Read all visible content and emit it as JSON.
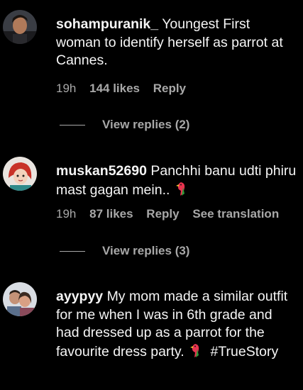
{
  "comments": [
    {
      "username": "sohampuranik_",
      "text": "Youngest First woman to identify herself as parrot at Cannes.",
      "time": "19h",
      "likes": "144 likes",
      "reply": "Reply",
      "view_replies": "View replies (2)"
    },
    {
      "username": "muskan52690",
      "text": "Panchhi banu udti phiru mast gagan mein..",
      "emoji": "parrot-emoji",
      "time": "19h",
      "likes": "87 likes",
      "reply": "Reply",
      "translation": "See translation",
      "view_replies": "View replies (3)"
    },
    {
      "username": "ayypyy",
      "text": "My mom made a similar outfit for me when I was in 6th grade and had dressed up as a parrot for the favourite dress party.",
      "emoji": "parrot-emoji",
      "hashtag": "#TrueStory"
    }
  ],
  "colors": {
    "background": "#000000",
    "text": "#f5f5f5",
    "secondary": "#a8a8a8"
  }
}
